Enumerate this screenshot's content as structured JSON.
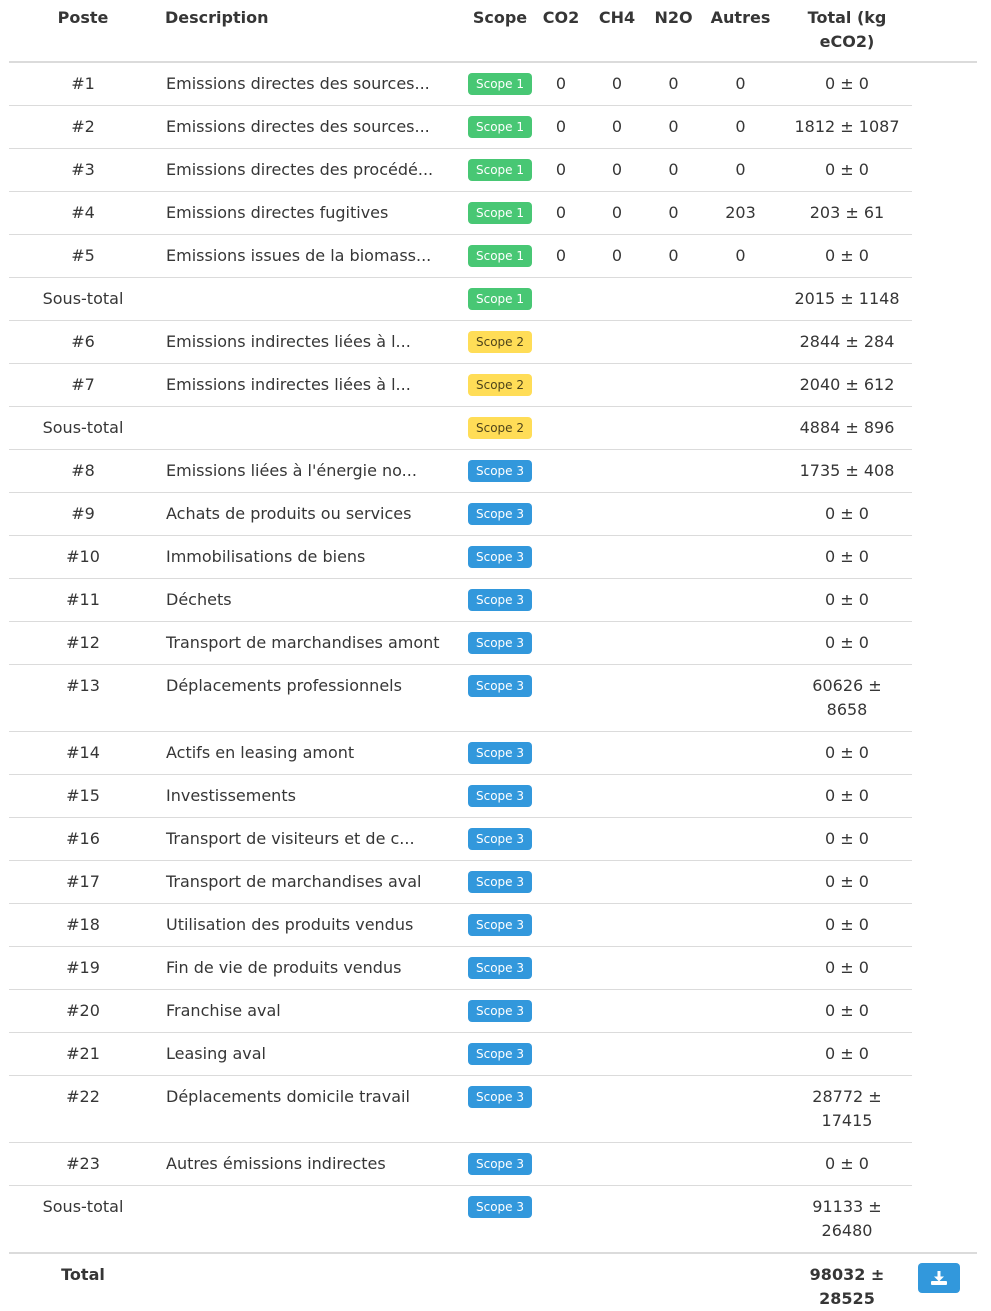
{
  "headers": {
    "poste": "Poste",
    "description": "Description",
    "scope": "Scope",
    "co2": "CO2",
    "ch4": "CH4",
    "n2o": "N2O",
    "autres": "Autres",
    "total": "Total (kg eCO2)"
  },
  "rows": [
    {
      "kind": "item",
      "poste": "#1",
      "description": "Emissions directes des sources...",
      "scope": "Scope 1",
      "scope_level": 1,
      "co2": "0",
      "ch4": "0",
      "n2o": "0",
      "autres": "0",
      "total": "0 ± 0"
    },
    {
      "kind": "item",
      "poste": "#2",
      "description": "Emissions directes des sources...",
      "scope": "Scope 1",
      "scope_level": 1,
      "co2": "0",
      "ch4": "0",
      "n2o": "0",
      "autres": "0",
      "total": "1812 ± 1087"
    },
    {
      "kind": "item",
      "poste": "#3",
      "description": "Emissions directes des procédé...",
      "scope": "Scope 1",
      "scope_level": 1,
      "co2": "0",
      "ch4": "0",
      "n2o": "0",
      "autres": "0",
      "total": "0 ± 0"
    },
    {
      "kind": "item",
      "poste": "#4",
      "description": "Emissions directes fugitives",
      "scope": "Scope 1",
      "scope_level": 1,
      "co2": "0",
      "ch4": "0",
      "n2o": "0",
      "autres": "203",
      "total": "203 ± 61"
    },
    {
      "kind": "item",
      "poste": "#5",
      "description": "Emissions issues de la biomass...",
      "scope": "Scope 1",
      "scope_level": 1,
      "co2": "0",
      "ch4": "0",
      "n2o": "0",
      "autres": "0",
      "total": "0 ± 0"
    },
    {
      "kind": "subtotal",
      "poste": "Sous-total",
      "description": "",
      "scope": "Scope 1",
      "scope_level": 1,
      "co2": "",
      "ch4": "",
      "n2o": "",
      "autres": "",
      "total": "2015 ± 1148"
    },
    {
      "kind": "item",
      "poste": "#6",
      "description": "Emissions indirectes liées à l...",
      "scope": "Scope 2",
      "scope_level": 2,
      "co2": "",
      "ch4": "",
      "n2o": "",
      "autres": "",
      "total": "2844 ± 284"
    },
    {
      "kind": "item",
      "poste": "#7",
      "description": "Emissions indirectes liées à l...",
      "scope": "Scope 2",
      "scope_level": 2,
      "co2": "",
      "ch4": "",
      "n2o": "",
      "autres": "",
      "total": "2040 ± 612"
    },
    {
      "kind": "subtotal",
      "poste": "Sous-total",
      "description": "",
      "scope": "Scope 2",
      "scope_level": 2,
      "co2": "",
      "ch4": "",
      "n2o": "",
      "autres": "",
      "total": "4884 ± 896"
    },
    {
      "kind": "item",
      "poste": "#8",
      "description": "Emissions liées à l'énergie no...",
      "scope": "Scope 3",
      "scope_level": 3,
      "co2": "",
      "ch4": "",
      "n2o": "",
      "autres": "",
      "total": "1735 ± 408"
    },
    {
      "kind": "item",
      "poste": "#9",
      "description": "Achats de produits ou services",
      "scope": "Scope 3",
      "scope_level": 3,
      "co2": "",
      "ch4": "",
      "n2o": "",
      "autres": "",
      "total": "0 ± 0"
    },
    {
      "kind": "item",
      "poste": "#10",
      "description": "Immobilisations de biens",
      "scope": "Scope 3",
      "scope_level": 3,
      "co2": "",
      "ch4": "",
      "n2o": "",
      "autres": "",
      "total": "0 ± 0"
    },
    {
      "kind": "item",
      "poste": "#11",
      "description": "Déchets",
      "scope": "Scope 3",
      "scope_level": 3,
      "co2": "",
      "ch4": "",
      "n2o": "",
      "autres": "",
      "total": "0 ± 0"
    },
    {
      "kind": "item",
      "poste": "#12",
      "description": "Transport de marchandises amont",
      "scope": "Scope 3",
      "scope_level": 3,
      "co2": "",
      "ch4": "",
      "n2o": "",
      "autres": "",
      "total": "0 ± 0"
    },
    {
      "kind": "item",
      "poste": "#13",
      "description": "Déplacements professionnels",
      "scope": "Scope 3",
      "scope_level": 3,
      "co2": "",
      "ch4": "",
      "n2o": "",
      "autres": "",
      "total": "60626 ± 8658"
    },
    {
      "kind": "item",
      "poste": "#14",
      "description": "Actifs en leasing amont",
      "scope": "Scope 3",
      "scope_level": 3,
      "co2": "",
      "ch4": "",
      "n2o": "",
      "autres": "",
      "total": "0 ± 0"
    },
    {
      "kind": "item",
      "poste": "#15",
      "description": "Investissements",
      "scope": "Scope 3",
      "scope_level": 3,
      "co2": "",
      "ch4": "",
      "n2o": "",
      "autres": "",
      "total": "0 ± 0"
    },
    {
      "kind": "item",
      "poste": "#16",
      "description": "Transport de visiteurs et de c...",
      "scope": "Scope 3",
      "scope_level": 3,
      "co2": "",
      "ch4": "",
      "n2o": "",
      "autres": "",
      "total": "0 ± 0"
    },
    {
      "kind": "item",
      "poste": "#17",
      "description": "Transport de marchandises aval",
      "scope": "Scope 3",
      "scope_level": 3,
      "co2": "",
      "ch4": "",
      "n2o": "",
      "autres": "",
      "total": "0 ± 0"
    },
    {
      "kind": "item",
      "poste": "#18",
      "description": "Utilisation des produits vendus",
      "scope": "Scope 3",
      "scope_level": 3,
      "co2": "",
      "ch4": "",
      "n2o": "",
      "autres": "",
      "total": "0 ± 0"
    },
    {
      "kind": "item",
      "poste": "#19",
      "description": "Fin de vie de produits vendus",
      "scope": "Scope 3",
      "scope_level": 3,
      "co2": "",
      "ch4": "",
      "n2o": "",
      "autres": "",
      "total": "0 ± 0"
    },
    {
      "kind": "item",
      "poste": "#20",
      "description": "Franchise aval",
      "scope": "Scope 3",
      "scope_level": 3,
      "co2": "",
      "ch4": "",
      "n2o": "",
      "autres": "",
      "total": "0 ± 0"
    },
    {
      "kind": "item",
      "poste": "#21",
      "description": "Leasing aval",
      "scope": "Scope 3",
      "scope_level": 3,
      "co2": "",
      "ch4": "",
      "n2o": "",
      "autres": "",
      "total": "0 ± 0"
    },
    {
      "kind": "item",
      "poste": "#22",
      "description": "Déplacements domicile travail",
      "scope": "Scope 3",
      "scope_level": 3,
      "co2": "",
      "ch4": "",
      "n2o": "",
      "autres": "",
      "total": "28772 ± 17415"
    },
    {
      "kind": "item",
      "poste": "#23",
      "description": "Autres émissions indirectes",
      "scope": "Scope 3",
      "scope_level": 3,
      "co2": "",
      "ch4": "",
      "n2o": "",
      "autres": "",
      "total": "0 ± 0"
    },
    {
      "kind": "subtotal",
      "poste": "Sous-total",
      "description": "",
      "scope": "Scope 3",
      "scope_level": 3,
      "co2": "",
      "ch4": "",
      "n2o": "",
      "autres": "",
      "total": "91133 ± 26480"
    }
  ],
  "footer": {
    "label": "Total",
    "total": "98032 ± 28525",
    "download_icon": "download-icon"
  },
  "colors": {
    "scope_1": "#48c774",
    "scope_2": "#ffdd57",
    "scope_3": "#3298dc",
    "button": "#3298dc"
  }
}
